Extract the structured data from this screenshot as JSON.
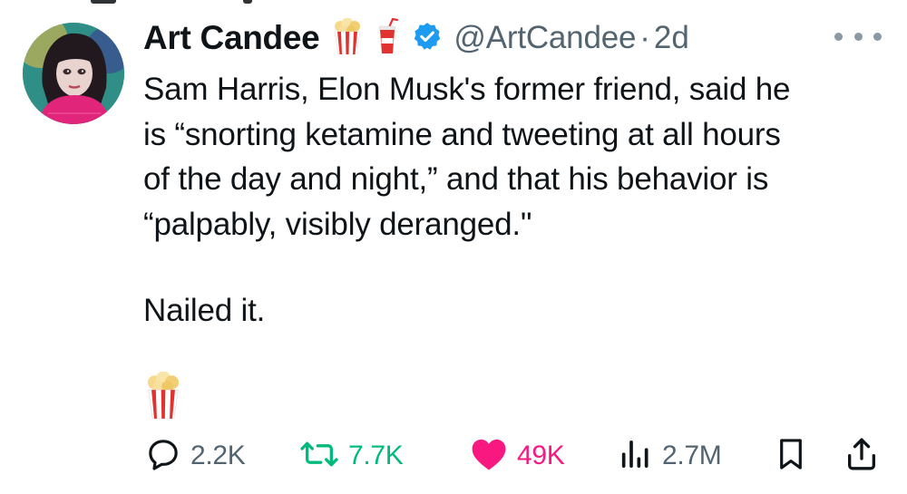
{
  "tweet": {
    "author_name": "Art Candee",
    "handle": "@ArtCandee",
    "separator": "·",
    "time": "2d",
    "name_emojis": [
      "popcorn-icon",
      "drink-cup-icon"
    ],
    "verified_color": "#1d9bf0",
    "text_lines": [
      "Sam Harris, Elon Musk's former friend, said he",
      "is “snorting ketamine and tweeting at all hours",
      "of the day and night,” and that his behavior is",
      "“palpably, visibly deranged.\""
    ],
    "text_followup": "Nailed it.",
    "trailing_emoji": "popcorn-icon"
  },
  "actions": {
    "replies": "2.2K",
    "retweets": "7.7K",
    "likes": "49K",
    "views": "2.7M"
  },
  "colors": {
    "text": "#0f1419",
    "muted": "#536471",
    "retweet": "#00ba7c",
    "like": "#f91880",
    "verified": "#1d9bf0"
  }
}
